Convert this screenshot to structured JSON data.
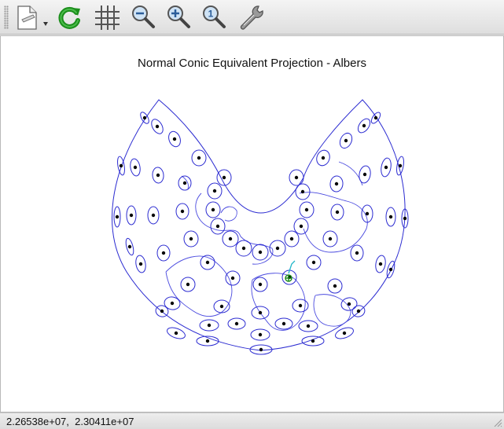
{
  "toolbar": {
    "buttons": [
      {
        "name": "new-document-menu-button",
        "icon": "document-icon"
      },
      {
        "name": "refresh-button",
        "icon": "refresh-icon"
      },
      {
        "name": "grid-toggle-button",
        "icon": "grid-icon"
      },
      {
        "name": "zoom-out-button",
        "icon": "zoom-out-icon"
      },
      {
        "name": "zoom-in-button",
        "icon": "zoom-in-icon"
      },
      {
        "name": "zoom-reset-button",
        "icon": "zoom-1-icon"
      },
      {
        "name": "settings-button",
        "icon": "wrench-icon"
      }
    ],
    "zoom_reset_glyph": "1"
  },
  "plot": {
    "title": "Normal Conic Equivalent Projection - Albers",
    "colors": {
      "outline": "#2b2bd1",
      "coast": "#4a4adf",
      "dot": "#000000",
      "marker": "#1a8a1a",
      "marker_cyan": "#23b7c9"
    }
  },
  "status": {
    "coordinates": "2.26538e+07,  2.30411e+07"
  }
}
